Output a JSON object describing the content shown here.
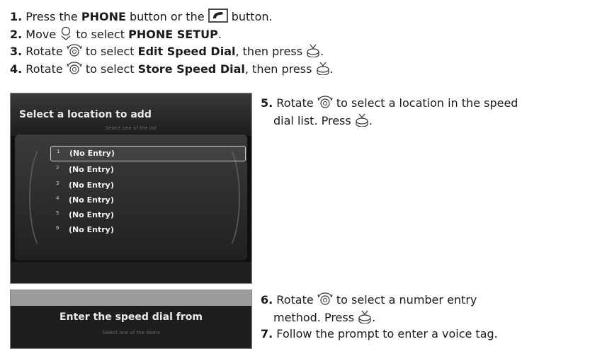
{
  "steps": [
    {
      "num": "1.",
      "a": " Press the ",
      "b1": "PHONE",
      "c": " button or the ",
      "d": " button."
    },
    {
      "num": "2.",
      "a": " Move ",
      "b": " to select ",
      "b1": "PHONE SETUP",
      "c": "."
    },
    {
      "num": "3.",
      "a": " Rotate ",
      "b": " to select ",
      "b1": "Edit Speed Dial",
      "c": ", then press ",
      "d": "."
    },
    {
      "num": "4.",
      "a": " Rotate ",
      "b": " to select ",
      "b1": "Store Speed Dial",
      "c": ", then press ",
      "d": "."
    },
    {
      "num": "5.",
      "a": " Rotate ",
      "b": " to select a location in the speed",
      "c": "dial list. Press ",
      "d": "."
    },
    {
      "num": "6.",
      "a": " Rotate ",
      "b": " to select a number entry",
      "c": "method. Press ",
      "d": "."
    },
    {
      "num": "7.",
      "a": " Follow the prompt to enter a voice tag."
    }
  ],
  "screen1": {
    "title": "Select a location to add",
    "subtitle": "Select one of the list",
    "rows": [
      {
        "idx": "1",
        "label": "(No Entry)"
      },
      {
        "idx": "2",
        "label": "(No Entry)"
      },
      {
        "idx": "3",
        "label": "(No Entry)"
      },
      {
        "idx": "4",
        "label": "(No Entry)"
      },
      {
        "idx": "5",
        "label": "(No Entry)"
      },
      {
        "idx": "6",
        "label": "(No Entry)"
      }
    ]
  },
  "screen2": {
    "title": "Enter the speed dial from",
    "subtitle": "Select one of the items"
  },
  "icons": {
    "phone": "phone-icon",
    "joystick": "joystick-down-icon",
    "knob": "rotate-knob-icon",
    "press": "press-knob-icon"
  }
}
